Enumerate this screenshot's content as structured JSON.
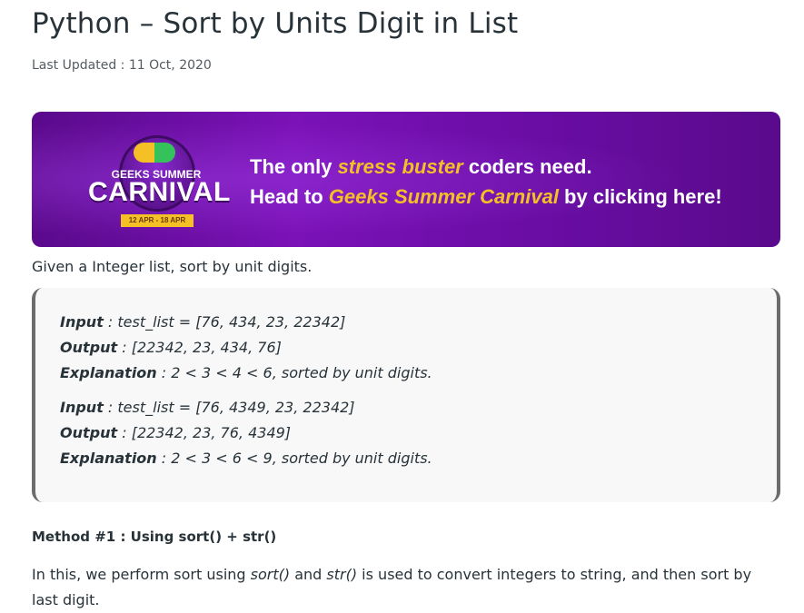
{
  "article": {
    "title": "Python – Sort by Units Digit in List",
    "last_updated": "Last Updated : 11 Oct, 2020"
  },
  "banner": {
    "badge_top": "GEEKS SUMMER",
    "badge_main": "CARNIVAL",
    "badge_dates": "12 APR - 18 APR",
    "line1_pre": "The only ",
    "line1_hl": "stress buster",
    "line1_post": " coders need.",
    "line2_pre": "Head to ",
    "line2_hl": "Geeks Summer Carnival",
    "line2_post": " by clicking here!",
    "colors": {
      "bg": "#6b0da6",
      "highlight": "#f5c026"
    }
  },
  "intro": "Given a Integer list, sort by unit digits.",
  "examples": [
    {
      "input_label": "Input",
      "input": " : test_list = [76, 434, 23, 22342]",
      "output_label": "Output",
      "output": " : [22342, 23, 434, 76]",
      "expl_label": "Explanation",
      "expl": " : 2 < 3 < 4 < 6, sorted by unit digits."
    },
    {
      "input_label": "Input",
      "input": " : test_list = [76, 4349, 23, 22342]",
      "output_label": "Output",
      "output": " : [22342, 23, 76, 4349]",
      "expl_label": "Explanation",
      "expl": " : 2 < 3 < 6 < 9, sorted by unit digits."
    }
  ],
  "method": {
    "heading": "Method #1 : Using sort() + str()"
  },
  "paragraph": {
    "pre": "In this, we perform sort using ",
    "code1": "sort()",
    "mid": " and ",
    "code2": "str()",
    "post": " is used to convert integers to string, and then sort by last digit."
  }
}
